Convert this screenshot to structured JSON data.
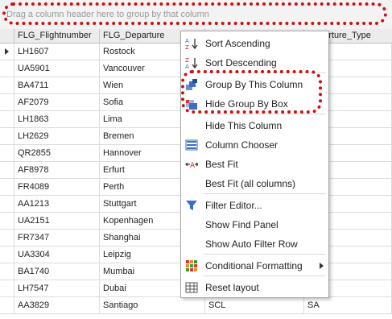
{
  "group_panel": {
    "hint": "Drag a column header here to group by that column"
  },
  "columns": [
    "FLG_Flightnumber",
    "FLG_Departure",
    "",
    "Departure_Type"
  ],
  "rows": [
    {
      "flight": "LH1607",
      "departure": "Rostock",
      "code": "",
      "type": ""
    },
    {
      "flight": "UA5901",
      "departure": "Vancouver",
      "code": "",
      "type": ""
    },
    {
      "flight": "BA4711",
      "departure": "Wien",
      "code": "",
      "type": ""
    },
    {
      "flight": "AF2079",
      "departure": "Sofia",
      "code": "",
      "type": ""
    },
    {
      "flight": "LH1863",
      "departure": "Lima",
      "code": "",
      "type": ""
    },
    {
      "flight": "LH2629",
      "departure": "Bremen",
      "code": "",
      "type": ""
    },
    {
      "flight": "QR2855",
      "departure": "Hannover",
      "code": "",
      "type": ""
    },
    {
      "flight": "AF8978",
      "departure": "Erfurt",
      "code": "",
      "type": ""
    },
    {
      "flight": "FR4089",
      "departure": "Perth",
      "code": "",
      "type": ""
    },
    {
      "flight": "AA1213",
      "departure": "Stuttgart",
      "code": "",
      "type": ""
    },
    {
      "flight": "UA2151",
      "departure": "Kopenhagen",
      "code": "",
      "type": ""
    },
    {
      "flight": "FR7347",
      "departure": "Shanghai",
      "code": "",
      "type": ""
    },
    {
      "flight": "UA3304",
      "departure": "Leipzig",
      "code": "",
      "type": ""
    },
    {
      "flight": "BA1740",
      "departure": "Mumbai",
      "code": "",
      "type": ""
    },
    {
      "flight": "LH7547",
      "departure": "Dubai",
      "code": "",
      "type": ""
    },
    {
      "flight": "AA3829",
      "departure": "Santiago",
      "code": "SCL",
      "type": "SA"
    }
  ],
  "context_menu": {
    "items": [
      {
        "label": "Sort Ascending",
        "icon": "sort-ascending-icon"
      },
      {
        "label": "Sort Descending",
        "icon": "sort-descending-icon"
      },
      {
        "label": "Group By This Column",
        "icon": "group-by-column-icon"
      },
      {
        "label": "Hide Group By Box",
        "icon": "hide-group-box-icon"
      },
      {
        "label": "Hide This Column",
        "icon": ""
      },
      {
        "label": "Column Chooser",
        "icon": "column-chooser-icon"
      },
      {
        "label": "Best Fit",
        "icon": "best-fit-icon"
      },
      {
        "label": "Best Fit (all columns)",
        "icon": ""
      },
      {
        "label": "Filter Editor...",
        "icon": "filter-icon"
      },
      {
        "label": "Show Find Panel",
        "icon": ""
      },
      {
        "label": "Show Auto Filter Row",
        "icon": ""
      },
      {
        "label": "Conditional Formatting",
        "icon": "conditional-formatting-icon"
      },
      {
        "label": "Reset layout",
        "icon": "reset-layout-icon"
      }
    ]
  },
  "colors": {
    "highlight": "#cc1111",
    "accent": "#3a6fc4"
  }
}
